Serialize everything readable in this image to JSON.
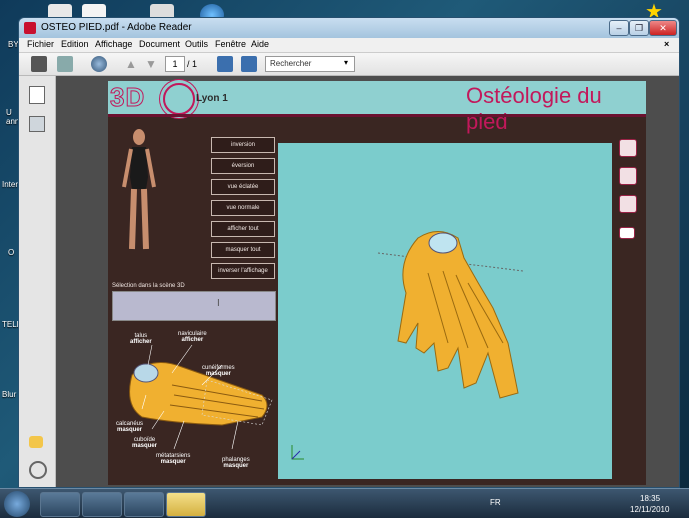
{
  "desktop": {
    "icon_labels": [
      "BY",
      "U\nann",
      "Inter",
      "O",
      "TELE",
      "Blur"
    ]
  },
  "window": {
    "title": "OSTEO PIED.pdf - Adobe Reader",
    "close_x": "×"
  },
  "menu": {
    "items": [
      "Fichier",
      "Edition",
      "Affichage",
      "Document",
      "Outils",
      "Fenêtre",
      "Aide"
    ]
  },
  "toolbar": {
    "page_current": "1",
    "page_total": "/ 1",
    "search_placeholder": "Rechercher"
  },
  "document": {
    "logo_text": "3D",
    "logo_city": "Lyon 1",
    "page_title": "Ostéologie du pied",
    "buttons": [
      "inversion",
      "éversion",
      "vue éclatée",
      "vue normale",
      "afficher tout",
      "masquer tout",
      "inverser l'affichage"
    ],
    "selection_label": "Sélection dans la scène 3D",
    "diagram_labels": [
      {
        "name": "talus",
        "action": "afficher"
      },
      {
        "name": "naviculaire",
        "action": "afficher"
      },
      {
        "name": "cunéiformes",
        "action": "masquer"
      },
      {
        "name": "calcanéus",
        "action": "masquer"
      },
      {
        "name": "cuboïde",
        "action": "masquer"
      },
      {
        "name": "métatarsiens",
        "action": "masquer"
      },
      {
        "name": "phalanges",
        "action": "masquer"
      }
    ]
  },
  "taskbar": {
    "language": "FR",
    "time": "18:35",
    "date": "12/11/2010"
  },
  "colors": {
    "page_bg": "#3a2622",
    "header_teal": "#8fd0d0",
    "title_magenta": "#c2185b",
    "viewport_teal": "#7bcccc",
    "bone_yellow": "#f0b030"
  }
}
